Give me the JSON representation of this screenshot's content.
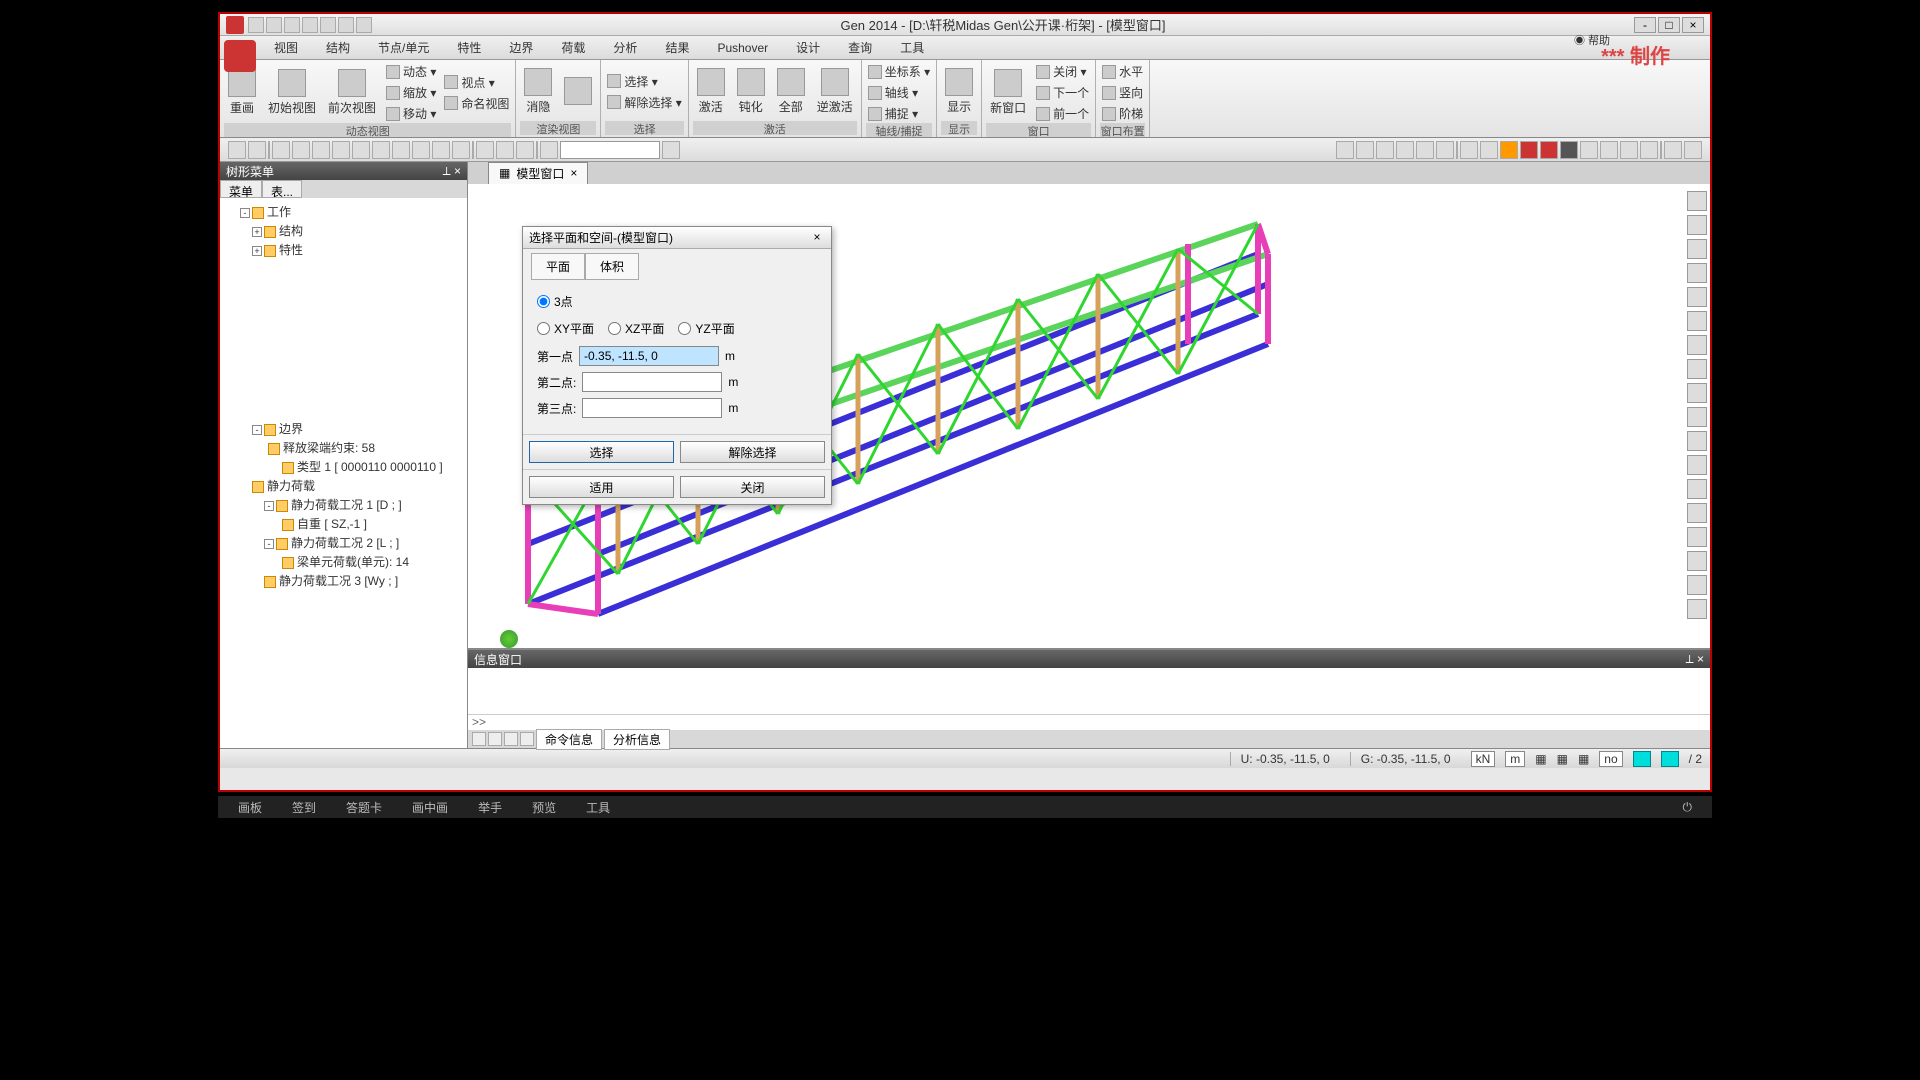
{
  "title": "Gen 2014 - [D:\\轩税Midas Gen\\公开课·桁架] - [模型窗口]",
  "watermark": "*** 制作",
  "help": "◉ 帮助",
  "menu": [
    "视图",
    "结构",
    "节点/单元",
    "特性",
    "边界",
    "荷载",
    "分析",
    "结果",
    "Pushover",
    "设计",
    "查询",
    "工具"
  ],
  "ribbon": {
    "g1": {
      "items": [
        "重画",
        "初始视图",
        "前次视图"
      ],
      "label": "动态视图",
      "side": [
        "动态 ▾",
        "缩放 ▾",
        "移动 ▾",
        "视点 ▾",
        "命名视图"
      ]
    },
    "g2": {
      "items": [
        "消隐"
      ],
      "label": "渲染视图"
    },
    "g3": {
      "side": [
        "选择 ▾",
        "解除选择 ▾"
      ],
      "label": "选择"
    },
    "g4": {
      "items": [
        "激活",
        "钝化",
        "全部",
        "逆激活"
      ],
      "label": "激活"
    },
    "g5": {
      "side": [
        "坐标系 ▾",
        "轴线 ▾",
        "捕捉 ▾"
      ],
      "label": "轴线/捕捉"
    },
    "g6": {
      "items": [
        "显示"
      ],
      "label": "显示"
    },
    "g7": {
      "items": [
        "新窗口"
      ],
      "side": [
        "关闭 ▾",
        "下一个",
        "前一个"
      ],
      "label": "窗口"
    },
    "g8": {
      "side": [
        "水平",
        "竖向",
        "阶梯"
      ],
      "label": "窗口布置"
    }
  },
  "tree": {
    "title": "树形菜单",
    "tabs": [
      "菜单",
      "表..."
    ],
    "n1": "工作",
    "n2": "结构",
    "n3": "特性",
    "n4": "边界",
    "n5": "释放梁端约束: 58",
    "n6": "类型 1 [ 0000110 0000110 ]",
    "n7": "静力荷载",
    "n8": "静力荷载工况 1 [D ; ]",
    "n9": "自重 [ SZ,-1 ]",
    "n10": "静力荷载工况 2 [L ; ]",
    "n11": "梁单元荷载(单元): 14",
    "n12": "静力荷载工况 3 [Wy ; ]"
  },
  "doctab": "模型窗口",
  "dialog": {
    "title": "选择平面和空间-(模型窗口)",
    "tab1": "平面",
    "tab2": "体积",
    "r1": "3点",
    "r2": "XY平面",
    "r3": "XZ平面",
    "r4": "YZ平面",
    "f1": "第一点",
    "f2": "第二点:",
    "f3": "第三点:",
    "v1": "-0.35, -11.5, 0",
    "b1": "选择",
    "b2": "解除选择",
    "b3": "适用",
    "b4": "关闭"
  },
  "msg": {
    "title": "信息窗口",
    "prompt": ">>",
    "t1": "命令信息",
    "t2": "分析信息"
  },
  "status": {
    "u": "U: -0.35, -11.5, 0",
    "g": "G: -0.35, -11.5, 0",
    "kn": "kN",
    "m": "m",
    "no": "no",
    "pg": "/ 2"
  },
  "bottom": [
    "画板",
    "签到",
    "答题卡",
    "画中画",
    "举手",
    "预览",
    "工具"
  ]
}
